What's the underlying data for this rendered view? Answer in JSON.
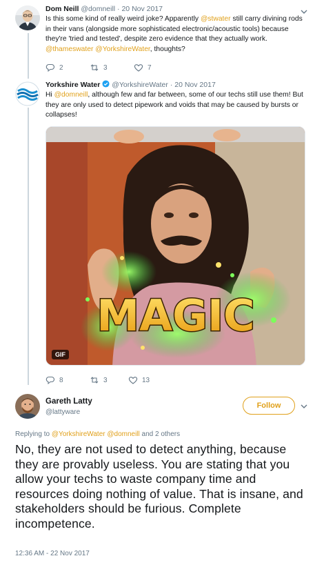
{
  "tweets": [
    {
      "name": "Dom Neill",
      "handle": "@domneill",
      "date": "20 Nov 2017",
      "text_parts": [
        {
          "t": "Is this some kind of really weird joke? Apparently ",
          "m": false
        },
        {
          "t": "@stwater",
          "m": true
        },
        {
          "t": " still carry divining rods in their vans (alongside more sophisticated electronic/acoustic tools) because they're 'tried and tested', despite zero evidence that they actually work. ",
          "m": false
        },
        {
          "t": "@thameswater",
          "m": true
        },
        {
          "t": " ",
          "m": false
        },
        {
          "t": "@YorkshireWater",
          "m": true
        },
        {
          "t": ", thoughts?",
          "m": false
        }
      ],
      "replies": "2",
      "retweets": "3",
      "likes": "7"
    },
    {
      "name": "Yorkshire Water",
      "handle": "@YorkshireWater",
      "date": "20 Nov 2017",
      "verified": true,
      "text_parts": [
        {
          "t": "Hi ",
          "m": false
        },
        {
          "t": "@domneill",
          "m": true
        },
        {
          "t": ", although few and far between, some of our techs still use them! But they are only used to detect pipework and voids that may be caused by bursts or collapses!",
          "m": false
        }
      ],
      "media": {
        "badge": "GIF",
        "caption": "MAGIC"
      },
      "replies": "8",
      "retweets": "3",
      "likes": "13"
    }
  ],
  "focus": {
    "name": "Gareth Latty",
    "handle": "@lattyware",
    "follow_label": "Follow",
    "reply_prefix": "Replying to ",
    "reply_mentions": "@YorkshireWater @domneill",
    "reply_suffix": " and 2 others",
    "text": "No, they are not used to detect anything, because they are provably useless. You are stating that you allow your techs to waste company time and resources doing nothing of value. That is insane, and stakeholders should be furious. Complete incompetence.",
    "timestamp": "12:36 AM - 22 Nov 2017"
  },
  "colors": {
    "accent": "#e0a01a",
    "text": "#14171a",
    "muted": "#657786",
    "verified": "#1da1f2"
  },
  "icons": [
    "reply-icon",
    "retweet-icon",
    "like-icon",
    "chevron-down-icon",
    "verified-badge-icon"
  ]
}
